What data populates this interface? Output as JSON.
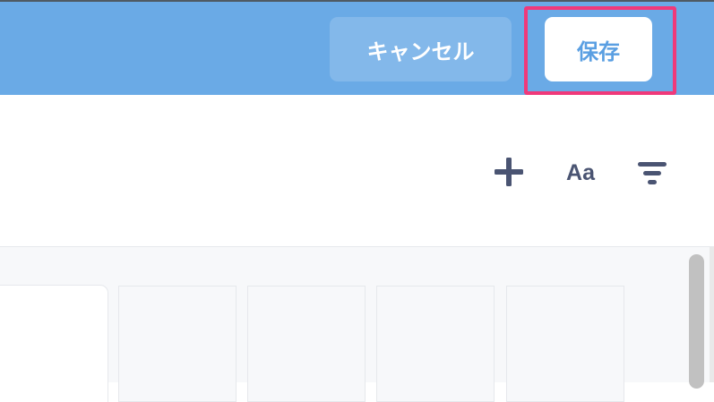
{
  "header": {
    "cancel_label": "キャンセル",
    "save_label": "保存",
    "background_color": "#6aaae6",
    "highlight_color": "#f0397a"
  },
  "toolbar": {
    "font_label": "Aa",
    "add_icon": "plus-icon",
    "filter_icon": "filter-icon",
    "icon_color": "#4a5472"
  },
  "content": {
    "background_color": "#f7f8fa"
  }
}
